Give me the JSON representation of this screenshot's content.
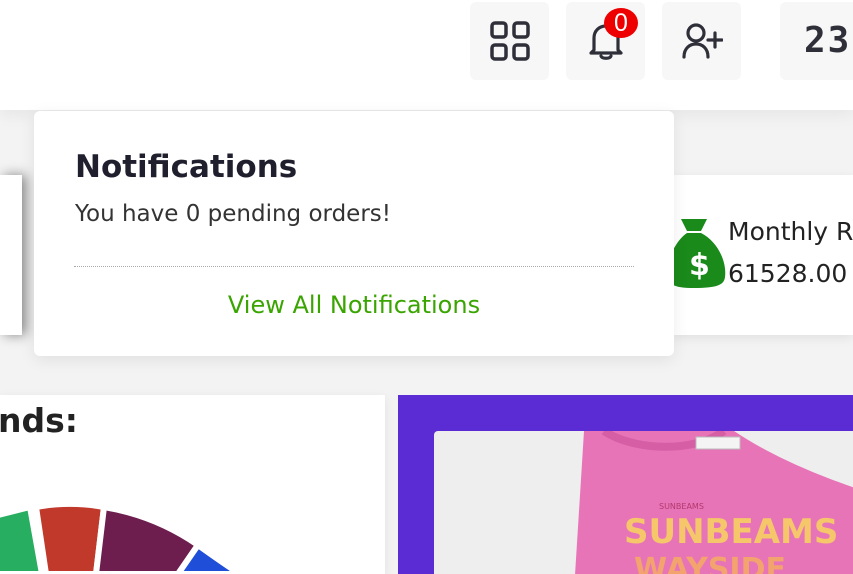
{
  "header": {
    "notification_count": "0",
    "last_button_text": "23"
  },
  "notifications": {
    "title": "Notifications",
    "message": "You have 0 pending orders!",
    "view_all": "View All Notifications"
  },
  "stat": {
    "label": "Monthly R",
    "value": "61528.00",
    "icon": "money-bag-icon",
    "icon_color": "#1a8a1a"
  },
  "trends": {
    "heading": "nds:",
    "pie_colors": [
      "#27ae60",
      "#c0392b",
      "#6d1e4f",
      "#1f4fd8"
    ]
  },
  "promo": {
    "background": "#5b2bd4",
    "shirt_color": "#e874b8",
    "print_text_1": "SUNBEAMS",
    "print_text_2": "WAYSIDE"
  },
  "accent_link_color": "#3aa400",
  "badge_color": "#ee0000"
}
